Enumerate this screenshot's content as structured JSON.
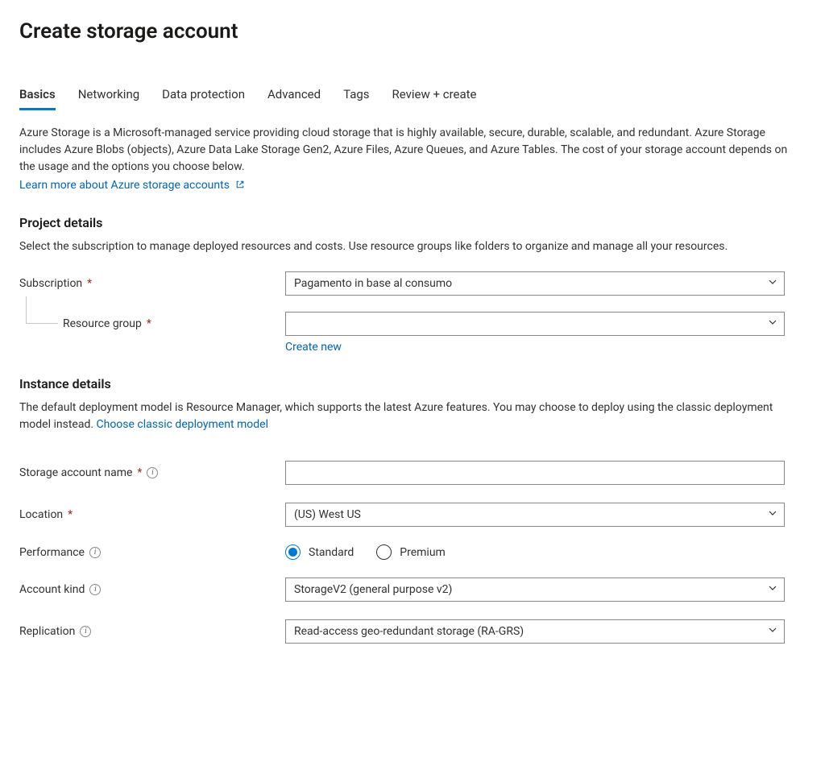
{
  "page": {
    "title": "Create storage account"
  },
  "tabs": [
    {
      "label": "Basics",
      "active": true
    },
    {
      "label": "Networking",
      "active": false
    },
    {
      "label": "Data protection",
      "active": false
    },
    {
      "label": "Advanced",
      "active": false
    },
    {
      "label": "Tags",
      "active": false
    },
    {
      "label": "Review + create",
      "active": false
    }
  ],
  "intro": {
    "text": "Azure Storage is a Microsoft-managed service providing cloud storage that is highly available, secure, durable, scalable, and redundant. Azure Storage includes Azure Blobs (objects), Azure Data Lake Storage Gen2, Azure Files, Azure Queues, and Azure Tables. The cost of your storage account depends on the usage and the options you choose below.",
    "learn_more": "Learn more about Azure storage accounts"
  },
  "project_details": {
    "title": "Project details",
    "desc": "Select the subscription to manage deployed resources and costs. Use resource groups like folders to organize and manage all your resources.",
    "subscription_label": "Subscription",
    "subscription_value": "Pagamento in base al consumo",
    "resource_group_label": "Resource group",
    "resource_group_value": "",
    "create_new": "Create new"
  },
  "instance_details": {
    "title": "Instance details",
    "desc_prefix": "The default deployment model is Resource Manager, which supports the latest Azure features. You may choose to deploy using the classic deployment model instead.  ",
    "classic_link": "Choose classic deployment model",
    "name_label": "Storage account name",
    "name_value": "",
    "location_label": "Location",
    "location_value": "(US) West US",
    "performance_label": "Performance",
    "performance_options": {
      "standard": "Standard",
      "premium": "Premium"
    },
    "account_kind_label": "Account kind",
    "account_kind_value": "StorageV2 (general purpose v2)",
    "replication_label": "Replication",
    "replication_value": "Read-access geo-redundant storage (RA-GRS)"
  }
}
